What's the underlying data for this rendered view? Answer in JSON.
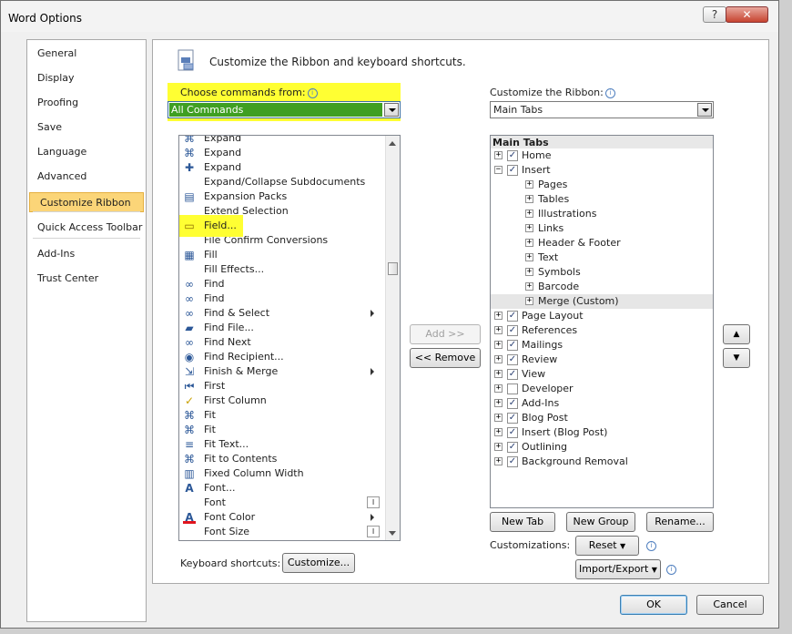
{
  "window": {
    "title": "Word Options",
    "help_label": "?",
    "close_label": "✕"
  },
  "nav": [
    {
      "label": "General"
    },
    {
      "label": "Display"
    },
    {
      "label": "Proofing"
    },
    {
      "label": "Save"
    },
    {
      "label": "Language"
    },
    {
      "label": "Advanced"
    },
    {
      "label": "Customize Ribbon",
      "selected": true
    },
    {
      "label": "Quick Access Toolbar"
    },
    {
      "label": "Add-Ins"
    },
    {
      "label": "Trust Center"
    }
  ],
  "header": {
    "text": "Customize the Ribbon and keyboard shortcuts."
  },
  "left": {
    "label": "Choose commands from:",
    "value": "All Commands",
    "commands": [
      {
        "icon": "expand-icon",
        "label": "Expand",
        "submenu": false
      },
      {
        "icon": "expand-icon",
        "label": "Expand",
        "submenu": false
      },
      {
        "icon": "plus-icon",
        "label": "Expand",
        "submenu": false
      },
      {
        "icon": "",
        "label": "Expand/Collapse Subdocuments",
        "submenu": false
      },
      {
        "icon": "expansion-packs-icon",
        "label": "Expansion Packs",
        "submenu": false
      },
      {
        "icon": "",
        "label": "Extend Selection",
        "submenu": false
      },
      {
        "icon": "field-icon",
        "label": "Field...",
        "submenu": false,
        "highlight": true
      },
      {
        "icon": "",
        "label": "File Confirm Conversions",
        "submenu": false
      },
      {
        "icon": "fill-icon",
        "label": "Fill",
        "submenu": false
      },
      {
        "icon": "",
        "label": "Fill Effects...",
        "submenu": false
      },
      {
        "icon": "binoculars-icon",
        "label": "Find",
        "submenu": false
      },
      {
        "icon": "binoculars-icon",
        "label": "Find",
        "submenu": false
      },
      {
        "icon": "binoculars-icon",
        "label": "Find & Select",
        "submenu": true
      },
      {
        "icon": "folder-icon",
        "label": "Find File...",
        "submenu": false
      },
      {
        "icon": "binoculars-icon",
        "label": "Find Next",
        "submenu": false
      },
      {
        "icon": "recipient-icon",
        "label": "Find Recipient...",
        "submenu": false
      },
      {
        "icon": "merge-icon",
        "label": "Finish & Merge",
        "submenu": true
      },
      {
        "icon": "first-icon",
        "label": "First",
        "submenu": false
      },
      {
        "icon": "check-icon",
        "label": "First Column",
        "submenu": false
      },
      {
        "icon": "fit-icon",
        "label": "Fit",
        "submenu": false
      },
      {
        "icon": "fit-icon",
        "label": "Fit",
        "submenu": false
      },
      {
        "icon": "fit-text-icon",
        "label": "Fit Text...",
        "submenu": false
      },
      {
        "icon": "fit-contents-icon",
        "label": "Fit to Contents",
        "submenu": false
      },
      {
        "icon": "column-width-icon",
        "label": "Fixed Column Width",
        "submenu": false
      },
      {
        "icon": "font-icon",
        "label": "Font...",
        "submenu": false
      },
      {
        "icon": "",
        "label": "Font",
        "submenu": false,
        "combo": true
      },
      {
        "icon": "font-color-icon",
        "label": "Font Color",
        "submenu": true
      },
      {
        "icon": "",
        "label": "Font Size",
        "submenu": false,
        "combo": true
      }
    ]
  },
  "middle": {
    "add_label": "Add >>",
    "remove_label": "<< Remove"
  },
  "right": {
    "label": "Customize the Ribbon:",
    "value": "Main Tabs",
    "tree_header": "Main Tabs",
    "tree": [
      {
        "label": "Home",
        "level": 0,
        "exp": "+",
        "checked": true
      },
      {
        "label": "Insert",
        "level": 0,
        "exp": "−",
        "checked": true
      },
      {
        "label": "Pages",
        "level": 1,
        "exp": "+"
      },
      {
        "label": "Tables",
        "level": 1,
        "exp": "+"
      },
      {
        "label": "Illustrations",
        "level": 1,
        "exp": "+"
      },
      {
        "label": "Links",
        "level": 1,
        "exp": "+"
      },
      {
        "label": "Header & Footer",
        "level": 1,
        "exp": "+"
      },
      {
        "label": "Text",
        "level": 1,
        "exp": "+"
      },
      {
        "label": "Symbols",
        "level": 1,
        "exp": "+"
      },
      {
        "label": "Barcode",
        "level": 1,
        "exp": "+"
      },
      {
        "label": "Merge (Custom)",
        "level": 1,
        "exp": "+",
        "selected": true
      },
      {
        "label": "Page Layout",
        "level": 0,
        "exp": "+",
        "checked": true
      },
      {
        "label": "References",
        "level": 0,
        "exp": "+",
        "checked": true
      },
      {
        "label": "Mailings",
        "level": 0,
        "exp": "+",
        "checked": true
      },
      {
        "label": "Review",
        "level": 0,
        "exp": "+",
        "checked": true
      },
      {
        "label": "View",
        "level": 0,
        "exp": "+",
        "checked": true
      },
      {
        "label": "Developer",
        "level": 0,
        "exp": "+",
        "checked": false
      },
      {
        "label": "Add-Ins",
        "level": 0,
        "exp": "+",
        "checked": true
      },
      {
        "label": "Blog Post",
        "level": 0,
        "exp": "+",
        "checked": true
      },
      {
        "label": "Insert (Blog Post)",
        "level": 0,
        "exp": "+",
        "checked": true
      },
      {
        "label": "Outlining",
        "level": 0,
        "exp": "+",
        "checked": true
      },
      {
        "label": "Background Removal",
        "level": 0,
        "exp": "+",
        "checked": true
      }
    ],
    "new_tab_label": "New Tab",
    "new_group_label": "New Group",
    "rename_label": "Rename...",
    "customizations_label": "Customizations:",
    "reset_label": "Reset",
    "import_export_label": "Import/Export",
    "move_up": "▲",
    "move_down": "▼"
  },
  "keyboard": {
    "label": "Keyboard shortcuts:",
    "button": "Customize..."
  },
  "footer": {
    "ok_label": "OK",
    "cancel_label": "Cancel"
  },
  "colors": {
    "highlight": "#ffff33",
    "selected_nav": "#fbd578",
    "combo_green": "#3f9f22"
  }
}
